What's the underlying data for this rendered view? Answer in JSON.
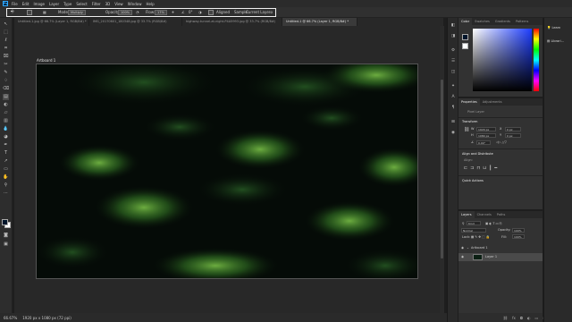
{
  "app": {
    "logo": "Ps"
  },
  "menu": [
    "File",
    "Edit",
    "Image",
    "Layer",
    "Type",
    "Select",
    "Filter",
    "3D",
    "View",
    "Window",
    "Help"
  ],
  "options": {
    "mode_label": "Mode:",
    "mode_value": "Multiply",
    "opacity_label": "Opacity:",
    "opacity_value": "100%",
    "flow_label": "Flow:",
    "flow_value": "17%",
    "angle_value": "0°",
    "aligned_label": "Aligned",
    "sample_label": "Sample:",
    "sample_value": "Current Layer"
  },
  "tabs": [
    {
      "label": "Untitled-1.jpg @ 66.7% (Layer 1, RGB/8#) *",
      "active": false
    },
    {
      "label": "IMG_20170601_180348.jpg @ 33.7% (RGB/8#)",
      "active": false
    },
    {
      "label": "highway-tunnel-at-night-P4A5993.jpg @ 33.7% (RGB/8#)",
      "active": false
    },
    {
      "label": "Untitled-1 @ 66.7% (Layer 1, RGB/8#) *",
      "active": true
    }
  ],
  "tools": [
    "↖",
    "⬚",
    "ℓ",
    "⌗",
    "⌧",
    "✂",
    "✎",
    "♢",
    "⌫",
    "▤",
    "◐",
    "✒",
    "T",
    "↗",
    "▭",
    "✋",
    "⚲",
    "⋯"
  ],
  "canvas": {
    "artboard_label": "Artboard 1"
  },
  "status": {
    "zoom": "66.67%",
    "doc_size": "1920 px x 1080 px (72 ppi)"
  },
  "icon_strip": [
    "◧",
    "◨",
    "⚙",
    "☰",
    "◫",
    "✦",
    "A",
    "¶",
    "⊞",
    "◉"
  ],
  "color_panel": {
    "tabs": [
      "Color",
      "Swatches",
      "Gradients",
      "Patterns"
    ],
    "fg_color": "#00152a",
    "bg_color": "#ffffff"
  },
  "properties": {
    "tabs": [
      "Properties",
      "Adjustments"
    ],
    "type_label": "Pixel Layer",
    "transform_header": "Transform",
    "w_label": "W",
    "w_value": "1920 px",
    "h_label": "H",
    "h_value": "1080 px",
    "x_label": "X",
    "x_value": "0 px",
    "y_label": "Y",
    "y_value": "0 px",
    "angle_value": "0.00°",
    "align_header": "Align and Distribute",
    "align_label": "Align:",
    "quick_actions": "Quick Actions"
  },
  "layers": {
    "tabs": [
      "Layers",
      "Channels",
      "Paths"
    ],
    "kind_label": "Kind",
    "blend_value": "Normal",
    "opacity_label": "Opacity:",
    "opacity_value": "100%",
    "lock_label": "Lock:",
    "fill_label": "Fill:",
    "fill_value": "100%",
    "artboard_name": "Artboard 1",
    "layer_name": "Layer 1"
  },
  "learn": {
    "learn_label": "Learn",
    "libraries_label": "Librari..."
  }
}
